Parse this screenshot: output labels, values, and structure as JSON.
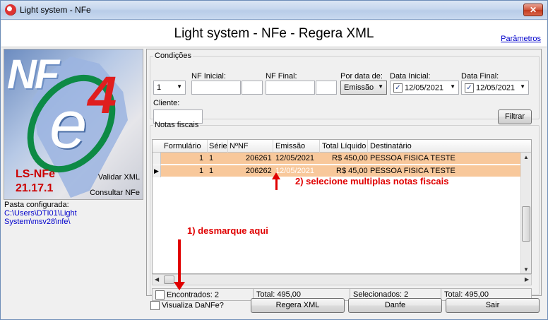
{
  "window": {
    "title": "Light system - NFe",
    "close_label": "✕"
  },
  "header": {
    "title": "Light system - NFe - Regera XML",
    "params_link": "Parâmetros"
  },
  "logo": {
    "nf": "NF",
    "e": "e",
    "four": "4",
    "product": "LS-NFe",
    "version": "21.17.1",
    "validar": "Validar XML",
    "consultar": "Consultar NFe"
  },
  "pasta": {
    "label": "Pasta configurada:",
    "value": "C:\\Users\\DTI01\\Light System\\msv28\\nfe\\"
  },
  "condicoes": {
    "legend": "Condições",
    "serie_value": "1",
    "nf_inicial_label": "NF Inicial:",
    "nf_final_label": "NF Final:",
    "por_data_label": "Por data de:",
    "por_data_value": "Emissão",
    "data_inicial_label": "Data Inicial:",
    "data_inicial_value": "12/05/2021",
    "data_final_label": "Data Final:",
    "data_final_value": "12/05/2021",
    "cliente_label": "Cliente:",
    "filtrar_label": "Filtrar",
    "check_mark": "✓"
  },
  "notas": {
    "legend": "Notas fiscais",
    "columns": [
      "Formulário",
      "Série",
      "NºNF",
      "Emissão",
      "Total Líquido",
      "Destinatário"
    ],
    "rows": [
      {
        "formulario": "1",
        "serie": "1",
        "nf": "206261",
        "emissao": "12/05/2021",
        "total": "R$ 450,00",
        "destinatario": "PESSOA FISICA TESTE"
      },
      {
        "formulario": "1",
        "serie": "1",
        "nf": "206262",
        "emissao": "12/05/2021",
        "total": "R$ 45,00",
        "destinatario": "PESSOA FISICA TESTE"
      }
    ],
    "current_marker": "▶"
  },
  "totals": {
    "encontrados": "Encontrados: 2",
    "total1": "Total: 495,00",
    "selecionados": "Selecionados: 2",
    "total2": "Total: 495,00"
  },
  "bottom": {
    "visualiza_label": "Visualiza DaNFe?",
    "regera_label": "Regera XML",
    "danfe_label": "Danfe",
    "sair_label": "Sair"
  },
  "annotations": {
    "step1": "1) desmarque aqui",
    "step2": "2) selecione multiplas notas fiscais",
    "color": "#e00000"
  }
}
